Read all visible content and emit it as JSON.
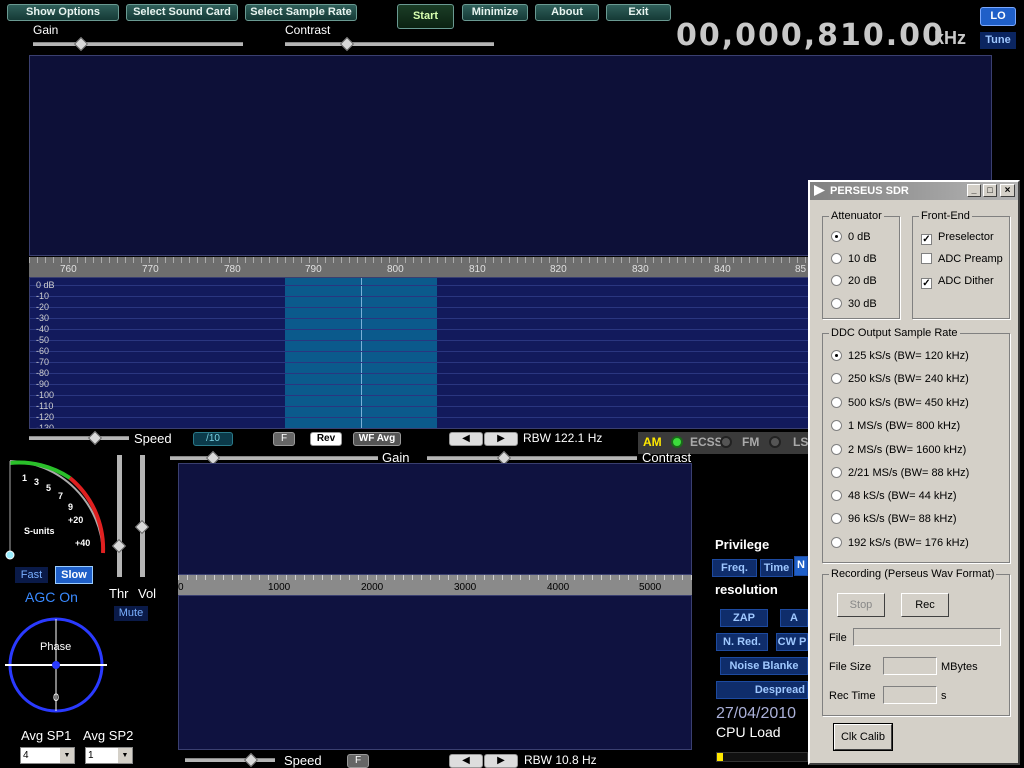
{
  "toolbar": {
    "show_options": "Show Options",
    "select_sound_card": "Select Sound Card",
    "select_sample_rate": "Select Sample Rate",
    "start": "Start",
    "minimize": "Minimize",
    "about": "About",
    "exit": "Exit"
  },
  "top_sliders": {
    "gain": "Gain",
    "contrast": "Contrast"
  },
  "frequency": {
    "value": "00,000,810.00",
    "unit": "kHz",
    "lo": "LO",
    "tune": "Tune"
  },
  "spectrum": {
    "x_ticks": [
      "760",
      "770",
      "780",
      "790",
      "800",
      "810",
      "820",
      "830",
      "840",
      "85"
    ],
    "db_labels": [
      "0  dB",
      "-10",
      "-20",
      "-30",
      "-40",
      "-50",
      "-60",
      "-70",
      "-80",
      "-90",
      "-100",
      "-110",
      "-120",
      "-130"
    ],
    "speed": "Speed",
    "speed_div": "/10",
    "f": "F",
    "rev": "Rev",
    "wf_avg": "WF Avg",
    "rbw": "RBW 122.1 Hz",
    "modes": [
      "AM",
      "ECSS",
      "FM",
      "LS"
    ],
    "gain": "Gain",
    "contrast": "Contrast"
  },
  "smeter": {
    "scale": [
      "1",
      "3",
      "5",
      "7",
      "9",
      "+20",
      "+40"
    ],
    "label": "S-units",
    "fast": "Fast",
    "slow": "Slow",
    "agc": "AGC On"
  },
  "sliders": {
    "thr": "Thr",
    "vol": "Vol",
    "mute": "Mute"
  },
  "phase": {
    "label": "Phase",
    "zero": "0"
  },
  "avg": {
    "sp1": "Avg SP1",
    "sp2": "Avg SP2",
    "sp1_value": "4",
    "sp2_value": "1"
  },
  "audio": {
    "x_ticks": [
      "0",
      "1000",
      "2000",
      "3000",
      "4000",
      "5000"
    ],
    "speed": "Speed",
    "f": "F",
    "rbw": "RBW 10.8 Hz"
  },
  "right_panel": {
    "privilege": "Privilege",
    "freq": "Freq.",
    "time": "Time",
    "n": "N",
    "resolution": "resolution",
    "zap": "ZAP",
    "a": "A",
    "nred": "N. Red.",
    "cwp": "CW P",
    "noise_blanker": "Noise Blanke",
    "despread": "Despread",
    "date": "27/04/2010",
    "cpu": "CPU Load"
  },
  "dialog": {
    "title": "PERSEUS SDR",
    "attenuator": "Attenuator",
    "att_options": [
      "0 dB",
      "10 dB",
      "20 dB",
      "30 dB"
    ],
    "frontend": "Front-End",
    "preselector": "Preselector",
    "adc_preamp": "ADC Preamp",
    "adc_dither": "ADC Dither",
    "ddc": "DDC Output Sample Rate",
    "ddc_options": [
      "125 kS/s (BW= 120 kHz)",
      "250 kS/s (BW= 240 kHz)",
      "500 kS/s (BW= 450 kHz)",
      "1 MS/s   (BW= 800 kHz)",
      "2 MS/s    (BW= 1600 kHz)",
      "2/21 MS/s    (BW= 88 kHz)",
      "48 kS/s   (BW= 44 kHz)",
      "96 kS/s   (BW= 88 kHz)",
      "192 kS/s (BW= 176 kHz)"
    ],
    "recording": "Recording (Perseus Wav Format)",
    "stop": "Stop",
    "rec": "Rec",
    "file": "File",
    "file_size": "File Size",
    "mbytes": "MBytes",
    "rec_time": "Rec Time",
    "s": "s",
    "clk_calib": "Clk Calib"
  },
  "colors": {
    "spectrum_bg": "#0d1038",
    "passband": "#0b5a8c",
    "accent": "#2a6aff"
  }
}
